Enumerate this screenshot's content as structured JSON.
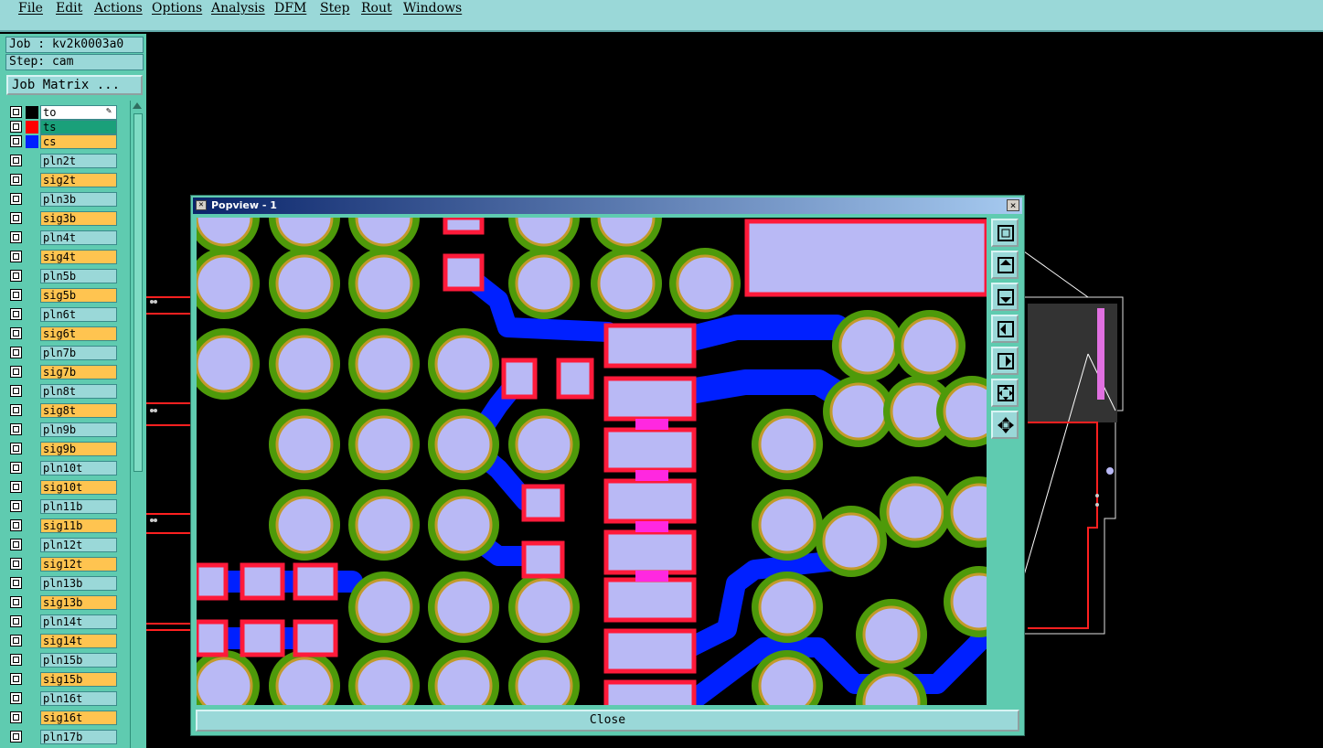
{
  "menu": [
    "File",
    "Edit",
    "Actions",
    "Options",
    "Analysis",
    "DFM",
    "Step",
    "Rout",
    "Windows"
  ],
  "job": {
    "label": "Job : kv2k0003a0",
    "step": "Step: cam",
    "matrix_button": "Job Matrix ..."
  },
  "layers": [
    {
      "name": "to",
      "kind": "active",
      "swatch": "#000000"
    },
    {
      "name": "ts",
      "kind": "green",
      "swatch": "#ff0000"
    },
    {
      "name": "cs",
      "kind": "signal",
      "swatch": "#0020ff"
    },
    {
      "name": "pln2t",
      "kind": "plane"
    },
    {
      "name": "sig2t",
      "kind": "signal"
    },
    {
      "name": "pln3b",
      "kind": "plane"
    },
    {
      "name": "sig3b",
      "kind": "signal"
    },
    {
      "name": "pln4t",
      "kind": "plane"
    },
    {
      "name": "sig4t",
      "kind": "signal"
    },
    {
      "name": "pln5b",
      "kind": "plane"
    },
    {
      "name": "sig5b",
      "kind": "signal"
    },
    {
      "name": "pln6t",
      "kind": "plane"
    },
    {
      "name": "sig6t",
      "kind": "signal"
    },
    {
      "name": "pln7b",
      "kind": "plane"
    },
    {
      "name": "sig7b",
      "kind": "signal"
    },
    {
      "name": "pln8t",
      "kind": "plane"
    },
    {
      "name": "sig8t",
      "kind": "signal"
    },
    {
      "name": "pln9b",
      "kind": "plane"
    },
    {
      "name": "sig9b",
      "kind": "signal"
    },
    {
      "name": "pln10t",
      "kind": "plane"
    },
    {
      "name": "sig10t",
      "kind": "signal"
    },
    {
      "name": "pln11b",
      "kind": "plane"
    },
    {
      "name": "sig11b",
      "kind": "signal"
    },
    {
      "name": "pln12t",
      "kind": "plane"
    },
    {
      "name": "sig12t",
      "kind": "signal"
    },
    {
      "name": "pln13b",
      "kind": "plane"
    },
    {
      "name": "sig13b",
      "kind": "signal"
    },
    {
      "name": "pln14t",
      "kind": "plane"
    },
    {
      "name": "sig14t",
      "kind": "signal"
    },
    {
      "name": "pln15b",
      "kind": "plane"
    },
    {
      "name": "sig15b",
      "kind": "signal"
    },
    {
      "name": "pln16t",
      "kind": "plane"
    },
    {
      "name": "sig16t",
      "kind": "signal"
    },
    {
      "name": "pln17b",
      "kind": "plane"
    }
  ],
  "popup": {
    "title": "Popview - 1",
    "close_label": "Close",
    "close_x": "×"
  },
  "tools": [
    {
      "name": "zoom-home-icon"
    },
    {
      "name": "pan-up-icon"
    },
    {
      "name": "pan-down-icon"
    },
    {
      "name": "pan-left-icon"
    },
    {
      "name": "pan-right-icon"
    },
    {
      "name": "zoom-fit-icon"
    },
    {
      "name": "zoom-out-icon"
    }
  ],
  "colors": {
    "menubar": "#9ad8d8",
    "panel": "#5fcbb0",
    "plane_layer": "#9ad8d8",
    "signal_layer": "#ffc450",
    "pad_fill": "#b9b9f5",
    "pad_ring": "#4e9a0a",
    "smd_border": "#ff1a3a",
    "trace": "#0020ff",
    "board_outline": "#ff2020"
  }
}
